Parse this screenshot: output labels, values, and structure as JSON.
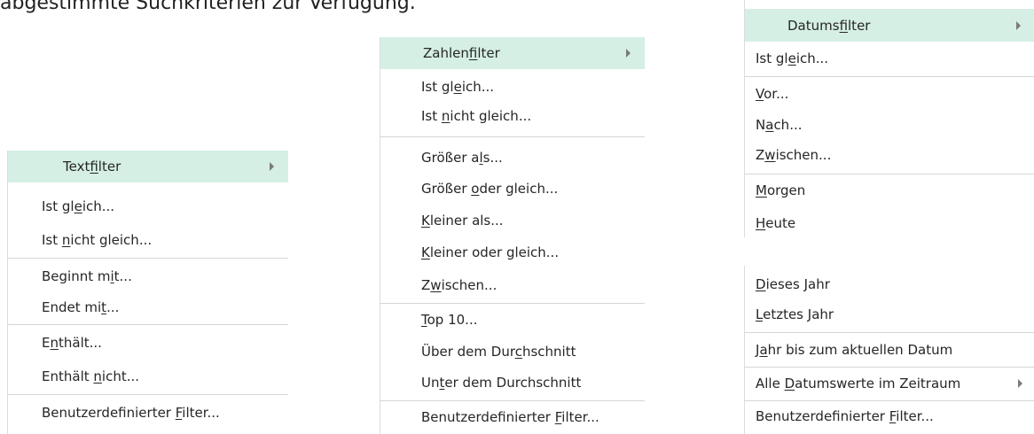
{
  "intro_text": "abgestimmte Suchkriterien zur Verfügung.",
  "menus": [
    {
      "title": [
        {
          "t": "Text"
        },
        {
          "t": "f",
          "u": true
        },
        {
          "t": "ilter"
        }
      ],
      "items": [
        [
          {
            "t": "Ist gl"
          },
          {
            "t": "e",
            "u": true
          },
          {
            "t": "ich..."
          }
        ],
        [
          {
            "t": "Ist "
          },
          {
            "t": "n",
            "u": true
          },
          {
            "t": "icht gleich..."
          }
        ],
        [
          {
            "t": "Beginnt m"
          },
          {
            "t": "i",
            "u": true
          },
          {
            "t": "t..."
          }
        ],
        [
          {
            "t": "Endet mi"
          },
          {
            "t": "t",
            "u": true
          },
          {
            "t": "..."
          }
        ],
        [
          {
            "t": "E"
          },
          {
            "t": "n",
            "u": true
          },
          {
            "t": "thält..."
          }
        ],
        [
          {
            "t": "Enthält "
          },
          {
            "t": "n",
            "u": true
          },
          {
            "t": "icht..."
          }
        ],
        [
          {
            "t": "Benutzerdefinierter "
          },
          {
            "t": "F",
            "u": true
          },
          {
            "t": "ilter..."
          }
        ]
      ]
    },
    {
      "title": [
        {
          "t": "Zahlen"
        },
        {
          "t": "f",
          "u": true
        },
        {
          "t": "ilter"
        }
      ],
      "items": [
        [
          {
            "t": "Ist gl"
          },
          {
            "t": "e",
            "u": true
          },
          {
            "t": "ich..."
          }
        ],
        [
          {
            "t": "Ist "
          },
          {
            "t": "n",
            "u": true
          },
          {
            "t": "icht gleich..."
          }
        ],
        [
          {
            "t": "Größer a"
          },
          {
            "t": "l",
            "u": true
          },
          {
            "t": "s..."
          }
        ],
        [
          {
            "t": "Größer "
          },
          {
            "t": "o",
            "u": true
          },
          {
            "t": "der gleich..."
          }
        ],
        [
          {
            "t": "K",
            "u": true
          },
          {
            "t": "leiner als..."
          }
        ],
        [
          {
            "t": "K",
            "u": true
          },
          {
            "t": "leiner oder gleich..."
          }
        ],
        [
          {
            "t": "Z"
          },
          {
            "t": "w",
            "u": true
          },
          {
            "t": "ischen..."
          }
        ],
        [
          {
            "t": "T",
            "u": true
          },
          {
            "t": "op 10..."
          }
        ],
        [
          {
            "t": "Über dem Dur"
          },
          {
            "t": "c",
            "u": true
          },
          {
            "t": "hschnitt"
          }
        ],
        [
          {
            "t": "Un"
          },
          {
            "t": "t",
            "u": true
          },
          {
            "t": "er dem Durchschnitt"
          }
        ],
        [
          {
            "t": "Benutzerdefinierter "
          },
          {
            "t": "F",
            "u": true
          },
          {
            "t": "ilter..."
          }
        ]
      ]
    },
    {
      "title": [
        {
          "t": "Datums"
        },
        {
          "t": "f",
          "u": true
        },
        {
          "t": "ilter"
        }
      ],
      "items": [
        [
          {
            "t": "Ist gl"
          },
          {
            "t": "e",
            "u": true
          },
          {
            "t": "ich..."
          }
        ],
        [
          {
            "t": "V",
            "u": true
          },
          {
            "t": "or..."
          }
        ],
        [
          {
            "t": "N"
          },
          {
            "t": "a",
            "u": true
          },
          {
            "t": "ch..."
          }
        ],
        [
          {
            "t": "Z"
          },
          {
            "t": "w",
            "u": true
          },
          {
            "t": "ischen..."
          }
        ],
        [
          {
            "t": "M",
            "u": true
          },
          {
            "t": "orgen"
          }
        ],
        [
          {
            "t": "H",
            "u": true
          },
          {
            "t": "eute"
          }
        ],
        [
          {
            "t": "D",
            "u": true
          },
          {
            "t": "ieses Jahr"
          }
        ],
        [
          {
            "t": "L",
            "u": true
          },
          {
            "t": "etztes Jahr"
          }
        ],
        [
          {
            "t": "J"
          },
          {
            "t": "a",
            "u": true
          },
          {
            "t": "hr bis zum aktuellen Datum"
          }
        ],
        [
          {
            "t": "Alle "
          },
          {
            "t": "D",
            "u": true
          },
          {
            "t": "atumswerte im Zeitraum"
          }
        ],
        [
          {
            "t": "Benutzerdefinierter "
          },
          {
            "t": "F",
            "u": true
          },
          {
            "t": "ilter..."
          }
        ]
      ]
    }
  ]
}
